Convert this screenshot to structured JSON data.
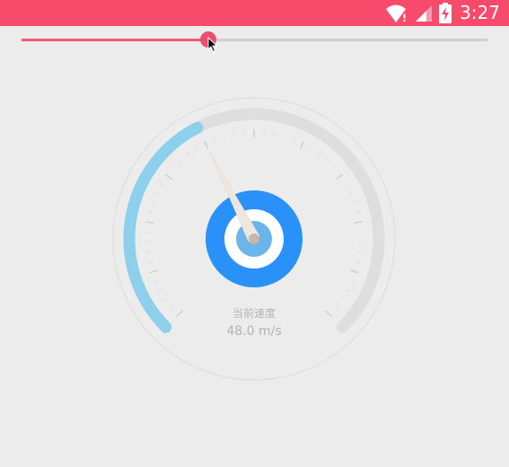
{
  "status_bar": {
    "time": "3:27",
    "color": "#f84a6a",
    "icons": [
      "wifi-icon",
      "cell-signal-icon",
      "battery-charging-icon"
    ]
  },
  "slider": {
    "value": 0.4,
    "track_color": "#cfcfcf",
    "active_color": "#ef5973"
  },
  "gauge": {
    "title": "当前速度",
    "speed": 48.0,
    "speed_text": "48.0 m/s",
    "progress_fraction": 0.4,
    "colors": {
      "progress": "#8dd0ec",
      "track": "#dedede",
      "hub": "#2a91f8",
      "pointer": "#efe6df"
    }
  }
}
